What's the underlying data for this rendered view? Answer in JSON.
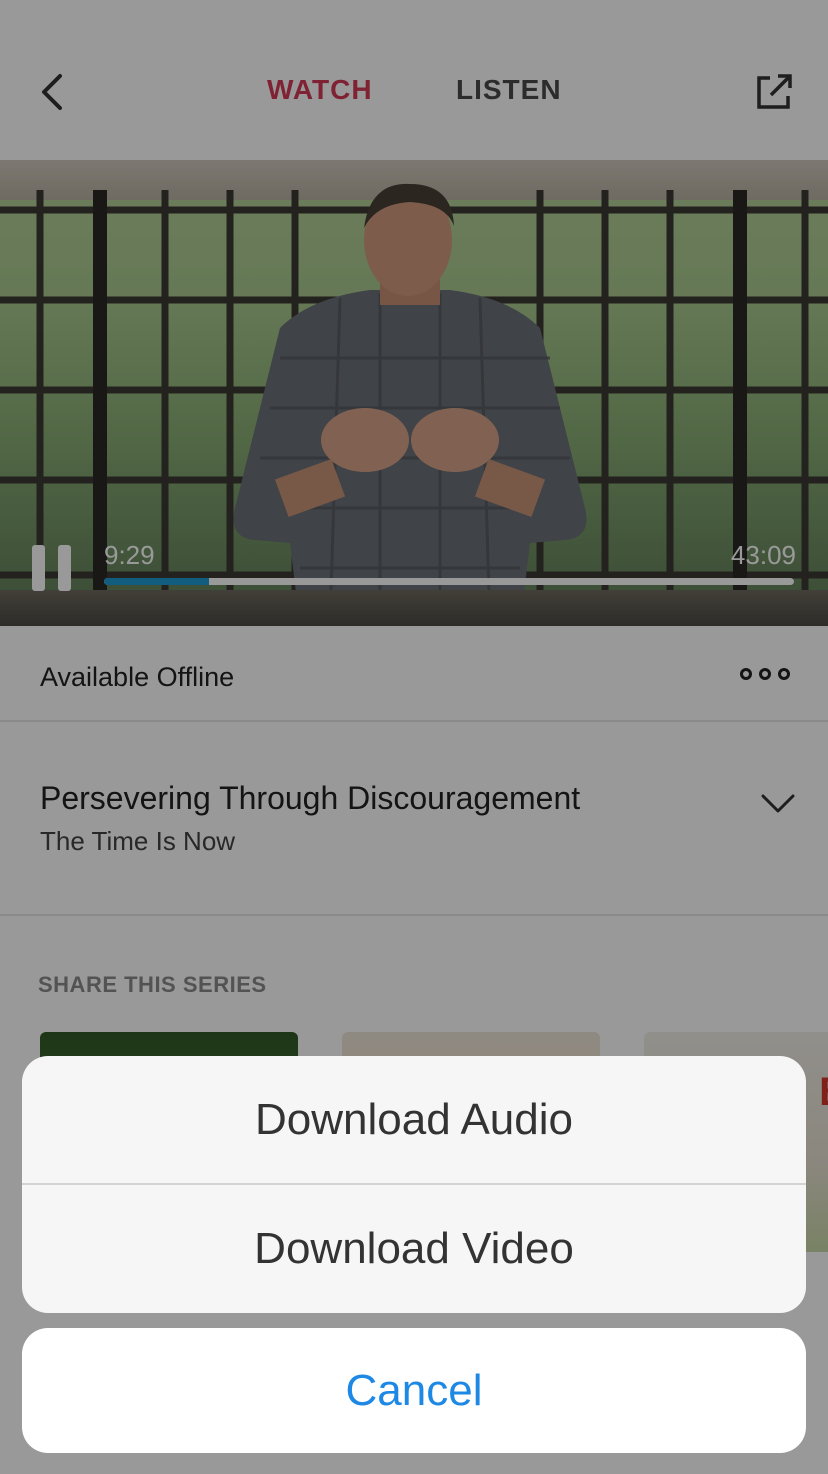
{
  "header": {
    "tabs": [
      {
        "label": "WATCH",
        "active": true
      },
      {
        "label": "LISTEN",
        "active": false
      }
    ],
    "active_tab_color": "#d43a57"
  },
  "player": {
    "current_time": "9:29",
    "total_time": "43:09",
    "progress_fraction": 0.152,
    "progress_color": "#1e9ad6",
    "state": "playing"
  },
  "offline": {
    "label": "Available Offline",
    "more_icon": "more-icon"
  },
  "message": {
    "title": "Persevering Through Discouragement",
    "subtitle": "The Time Is Now"
  },
  "share_section": {
    "heading": "SHARE THIS SERIES"
  },
  "action_sheet": {
    "options": [
      "Download Audio",
      "Download Video"
    ],
    "cancel_label": "Cancel",
    "cancel_color": "#1e88e5"
  }
}
